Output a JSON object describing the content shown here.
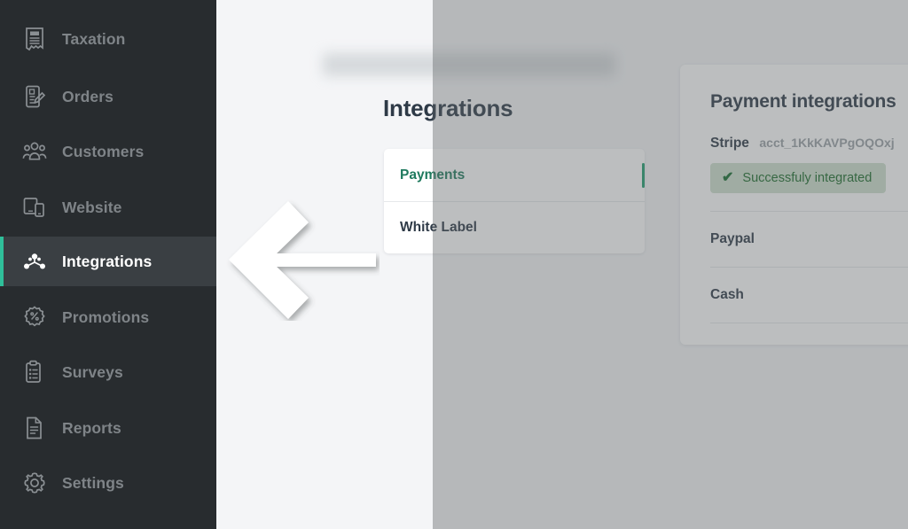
{
  "sidebar": {
    "background_color": "#282c2f",
    "active_accent_color": "#2fbf9a",
    "items": [
      {
        "label": "Taxation",
        "icon": "tax-receipt-icon",
        "active": false
      },
      {
        "label": "Orders",
        "icon": "order-form-icon",
        "active": false
      },
      {
        "label": "Customers",
        "icon": "customers-icon",
        "active": false
      },
      {
        "label": "Website",
        "icon": "devices-icon",
        "active": false
      },
      {
        "label": "Integrations",
        "icon": "integrations-icon",
        "active": true
      },
      {
        "label": "Promotions",
        "icon": "discount-badge-icon",
        "active": false
      },
      {
        "label": "Surveys",
        "icon": "clipboard-list-icon",
        "active": false
      },
      {
        "label": "Reports",
        "icon": "document-icon",
        "active": false
      },
      {
        "label": "Settings",
        "icon": "gear-icon",
        "active": false
      }
    ]
  },
  "main": {
    "page_title": "Integrations",
    "menu_card": {
      "items": [
        {
          "label": "Payments",
          "active": true
        },
        {
          "label": "White Label",
          "active": false
        }
      ],
      "active_indicator_color": "#1f9d6e"
    },
    "payment_card": {
      "title": "Payment integrations",
      "providers": [
        {
          "name": "Stripe",
          "account": "acct_1KkKAVPgOQOxj",
          "status_text": "Successfuly integrated",
          "status_icon": "check-icon",
          "status_bg": "#cfe0cf",
          "status_color": "#1b6b2a"
        },
        {
          "name": "Paypal",
          "account": "",
          "status_text": ""
        },
        {
          "name": "Cash",
          "account": "",
          "status_text": ""
        }
      ]
    }
  },
  "annotation": {
    "arrow": "left-arrow-annotation",
    "color": "#ffffff"
  }
}
